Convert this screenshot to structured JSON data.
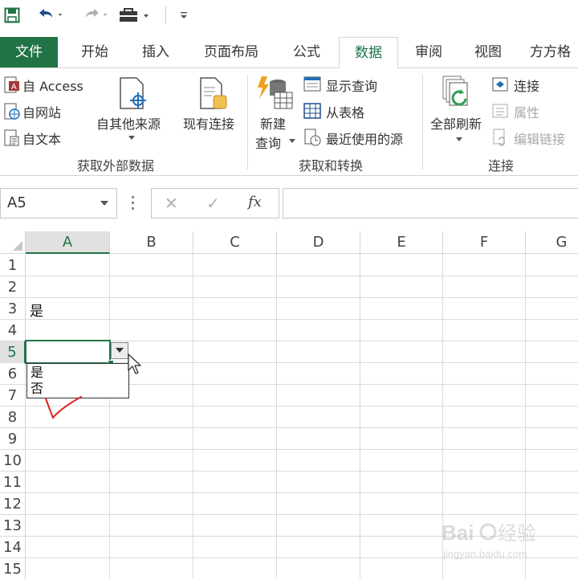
{
  "qat": {
    "save_icon": "save-icon",
    "undo_icon": "undo-icon",
    "redo_icon": "redo-icon",
    "customize_icon": "toolbox-icon",
    "more_icon": "customize-qat-icon"
  },
  "tabs": {
    "file": "文件",
    "home": "开始",
    "insert": "插入",
    "layout": "页面布局",
    "formulas": "公式",
    "data": "数据",
    "review": "审阅",
    "view": "视图",
    "addin": "方方格"
  },
  "ribbon": {
    "get_external": {
      "access": "自 Access",
      "web": "自网站",
      "text": "自文本",
      "other_sources": "自其他来源",
      "existing": "现有连接",
      "group_label": "获取外部数据"
    },
    "get_transform": {
      "new_query_line1": "新建",
      "new_query_line2": "查询",
      "show_queries": "显示查询",
      "from_table": "从表格",
      "recent_sources": "最近使用的源",
      "group_label": "获取和转换"
    },
    "connections": {
      "refresh_all": "全部刷新",
      "connections": "连接",
      "properties": "属性",
      "edit_links": "编辑链接",
      "group_label": "连接"
    }
  },
  "formula_bar": {
    "name_box": "A5",
    "cancel": "✕",
    "enter": "✓",
    "fx": "fx",
    "formula": ""
  },
  "grid": {
    "columns": [
      "A",
      "B",
      "C",
      "D",
      "E",
      "F",
      "G"
    ],
    "rows": [
      "1",
      "2",
      "3",
      "4",
      "5",
      "6",
      "7",
      "8",
      "9",
      "10",
      "11",
      "12",
      "13",
      "14",
      "15"
    ],
    "selected_column": "A",
    "selected_row": "5",
    "cell_A3": "是",
    "dropdown_options": [
      "是",
      "否"
    ]
  },
  "colors": {
    "accent": "#217346",
    "annotation_check": "#e02020"
  },
  "watermark": "Baidu经验 jingyan.baidu.com"
}
